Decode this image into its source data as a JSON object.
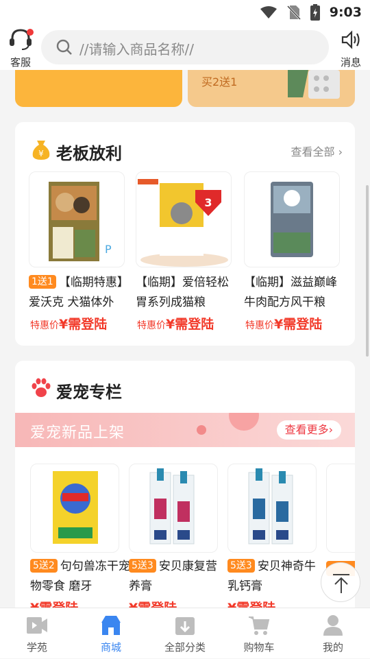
{
  "status_bar": {
    "time": "9:03"
  },
  "header": {
    "service_label": "客服",
    "search_placeholder": "//请输入商品名称//",
    "message_label": "消息"
  },
  "banners": {
    "right_text": "买2送1"
  },
  "boss_deals": {
    "title": "老板放利",
    "see_all": "查看全部",
    "items": [
      {
        "tag": "1送1",
        "name": "【临期特惠】爱沃克 犬猫体外驱虫滴剂",
        "price_label": "特惠价",
        "price": "¥需登陆"
      },
      {
        "name": "【临期】爱倍轻松胃系列成猫粮",
        "price_label": "特惠价",
        "price": "¥需登陆"
      },
      {
        "name": "【临期】滋益巅峰 牛肉配方风干粮",
        "price_label": "特惠价",
        "price": "¥需登陆"
      }
    ]
  },
  "pet_column": {
    "title": "爱宠专栏",
    "promo_title": "爱宠新品上架",
    "promo_more": "查看更多",
    "items": [
      {
        "tag": "5送2",
        "name": "句句兽冻干宠物零食 磨牙",
        "price": "¥需登陆"
      },
      {
        "tag": "5送3",
        "name": "安贝康复营养膏",
        "price": "¥需登陆"
      },
      {
        "tag": "5送3",
        "name": "安贝神奇牛乳钙膏",
        "price": "¥需登陆"
      }
    ]
  },
  "tabs": [
    {
      "label": "学苑"
    },
    {
      "label": "商城"
    },
    {
      "label": "全部分类"
    },
    {
      "label": "购物车"
    },
    {
      "label": "我的"
    }
  ],
  "colors": {
    "accent": "#3a86f0",
    "price": "#f23a2a",
    "tag": "#ff8a1f"
  }
}
